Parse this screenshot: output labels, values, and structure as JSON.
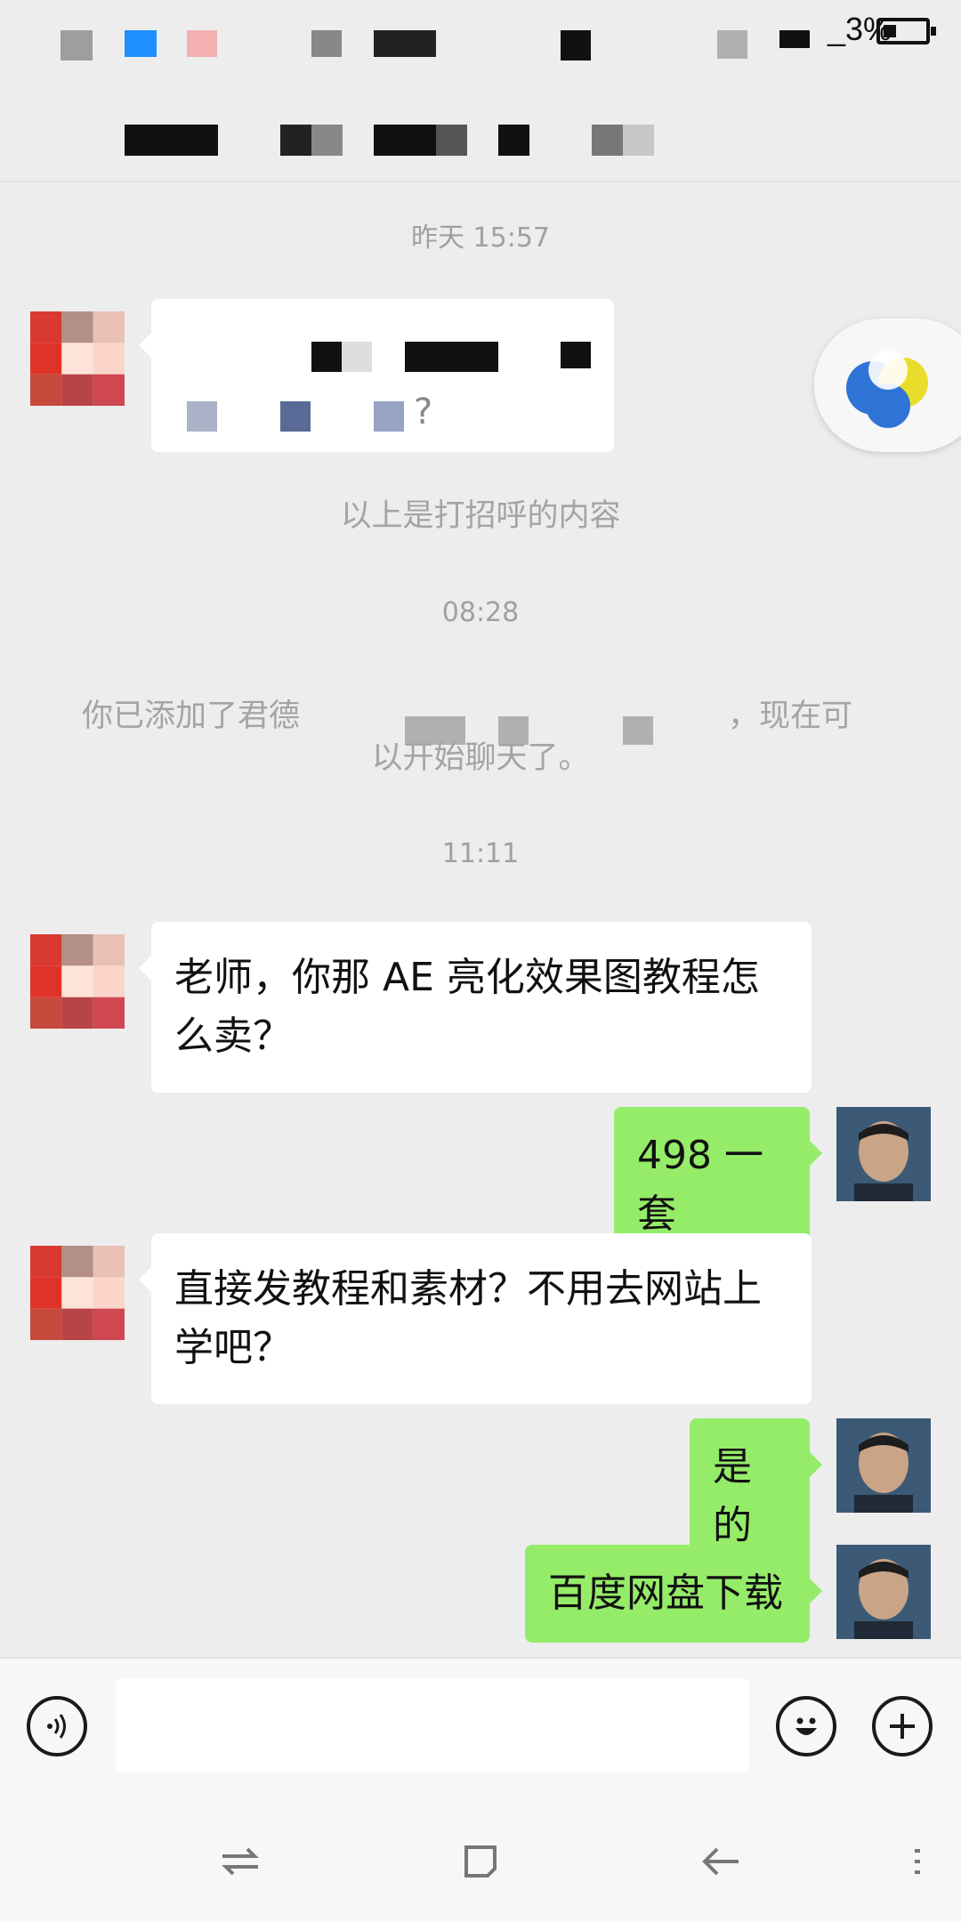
{
  "status_bar": {
    "battery_text": "_3%"
  },
  "chat": {
    "entries": {
      "t1": "昨天 15:57",
      "t2": "08:28",
      "t3": "11:11",
      "greet_note": "以上是打招呼的内容",
      "greet_fragment": "?",
      "added_line1_start": "你已添加了君德",
      "added_line1_end": "，现在可",
      "added_line2": "以开始聊天了。",
      "msg1": "老师，你那 AE 亮化效果图教程怎么卖？",
      "reply1": "498 一套",
      "msg2": "直接发教程和素材？不用去网站上学吧？",
      "reply2": "是的",
      "reply3": "百度网盘下载"
    }
  },
  "input_bar": {
    "placeholder": ""
  },
  "icons": {
    "voice": "voice-icon",
    "emoji": "emoji-icon",
    "add": "add-icon",
    "nav_switch": "switch-icon",
    "nav_home": "home-icon",
    "nav_back": "back-icon",
    "nav_menu": "menu-icon"
  },
  "colors": {
    "background": "#ededed",
    "my_bubble": "#95ec69",
    "friend_bubble": "#ffffff",
    "timestamp": "#a0a0a0"
  }
}
